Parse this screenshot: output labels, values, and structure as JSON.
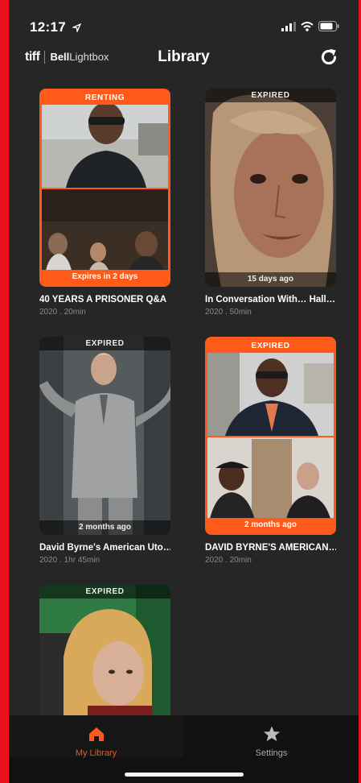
{
  "status_bar": {
    "time": "12:17"
  },
  "header": {
    "logo_tiff": "tiff",
    "logo_bell": "Bell",
    "logo_lightbox": "Lightbox",
    "title": "Library"
  },
  "items": [
    {
      "badge": "RENTING",
      "footer": "Expires in 2 days",
      "title": "40 YEARS A PRISONER Q&A",
      "meta": "2020 . 20min"
    },
    {
      "badge": "EXPIRED",
      "footer": "15 days ago",
      "title": "In Conversation With… Hall…",
      "meta": "2020 . 50min"
    },
    {
      "badge": "EXPIRED",
      "footer": "2 months ago",
      "title": "David Byrne's American Uto…",
      "meta": "2020 . 1hr 45min"
    },
    {
      "badge": "EXPIRED",
      "footer": "2 months ago",
      "title": "DAVID BYRNE'S AMERICAN…",
      "meta": "2020 . 20min"
    },
    {
      "badge": "EXPIRED"
    }
  ],
  "tabbar": {
    "my_library": "My Library",
    "settings": "Settings"
  },
  "colors": {
    "accent": "#ff5a1a",
    "background": "#262626"
  },
  "icons": [
    "location-arrow-icon",
    "signal-icon",
    "wifi-icon",
    "battery-icon",
    "refresh-icon",
    "home-icon",
    "star-icon"
  ]
}
